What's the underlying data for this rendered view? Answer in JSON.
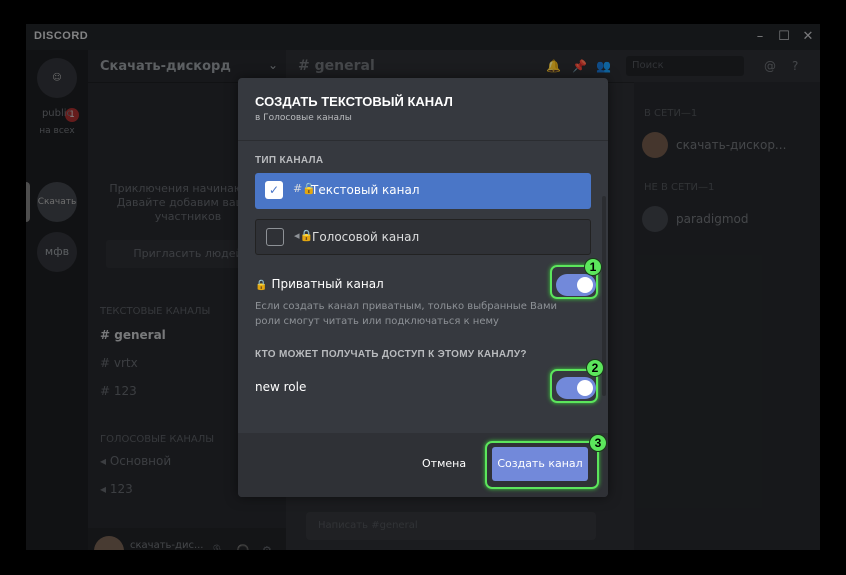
{
  "titlebar": {
    "brand": "DISCORD",
    "controls": [
      "–",
      "☐",
      "✕"
    ]
  },
  "rail": {
    "public_label": "public",
    "public_sub": "на всех",
    "badge": "1",
    "server1": "Скачать",
    "server2": "мфв"
  },
  "sidebar": {
    "guild_name": "Скачать-дискорд",
    "welcome": "Приключения начинаются! Давайте добавим ваших участников",
    "invite": "Пригласить людей",
    "cat_text": "ТЕКСТОВЫЕ КАНАЛЫ",
    "channels_text": [
      "general",
      "vrtx",
      "123"
    ],
    "cat_voice": "ГОЛОСОВЫЕ КАНАЛЫ",
    "channels_voice": [
      "Основной",
      "123"
    ]
  },
  "user": {
    "name": "скачать-дис...",
    "tag": "#0000"
  },
  "chat": {
    "channel": "general",
    "search_placeholder": "Поиск",
    "message_placeholder": "Написать #general"
  },
  "members": {
    "online_cat": "В СЕТИ—1",
    "online_user": "скачать-дискор...",
    "offline_cat": "НЕ В СЕТИ—1",
    "offline_user": "paradigmod"
  },
  "modal": {
    "title": "СОЗДАТЬ ТЕКСТОВЫЙ КАНАЛ",
    "subtitle": "в Голосовые каналы",
    "type_header": "ТИП КАНАЛА",
    "option_text": "Текстовый канал",
    "option_voice": "Голосовой канал",
    "private_label": "Приватный канал",
    "private_hint": "Если создать канал приватным, только выбранные Вами роли смогут читать или подключаться к нему",
    "access_header": "КТО МОЖЕТ ПОЛУЧАТЬ ДОСТУП К ЭТОМУ КАНАЛУ?",
    "role_label": "new role",
    "cancel": "Отмена",
    "create": "Создать канал",
    "private_enabled": true,
    "role_enabled": true
  },
  "annotations": [
    "1",
    "2",
    "3"
  ]
}
